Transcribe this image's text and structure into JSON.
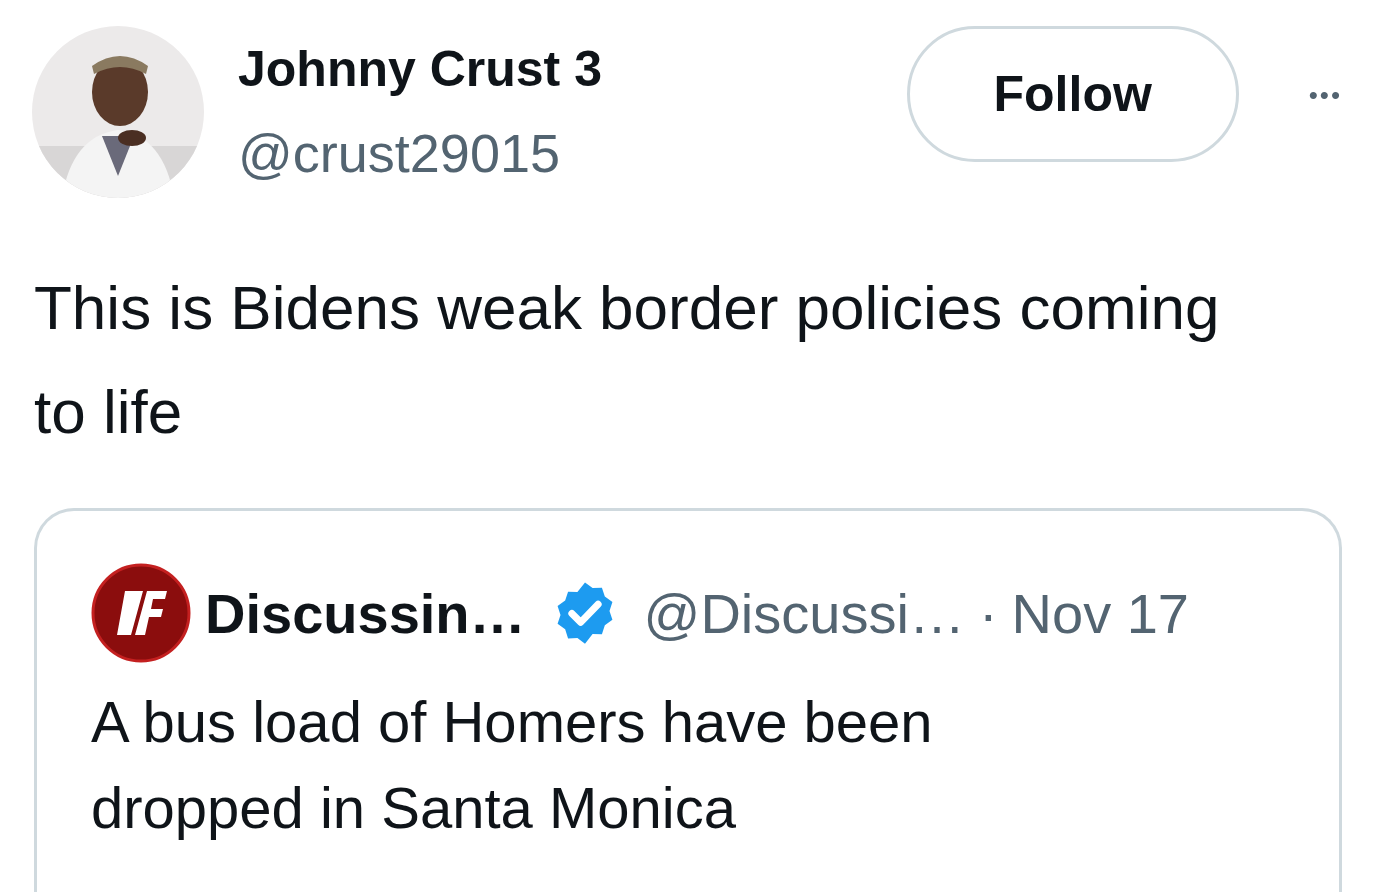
{
  "author": {
    "name": "Johnny Crust 3",
    "handle": "@crust29015"
  },
  "follow_button": {
    "label": "Follow"
  },
  "more_button": {
    "label": "•••"
  },
  "tweet_text": "This is Bidens weak border policies coming to life",
  "quoted_tweet": {
    "name": "Discussin…",
    "verified": true,
    "handle": "@Discussi…",
    "separator": "·",
    "date": "Nov 17",
    "text": "A bus load of Homers have been dropped in Santa Monica"
  }
}
